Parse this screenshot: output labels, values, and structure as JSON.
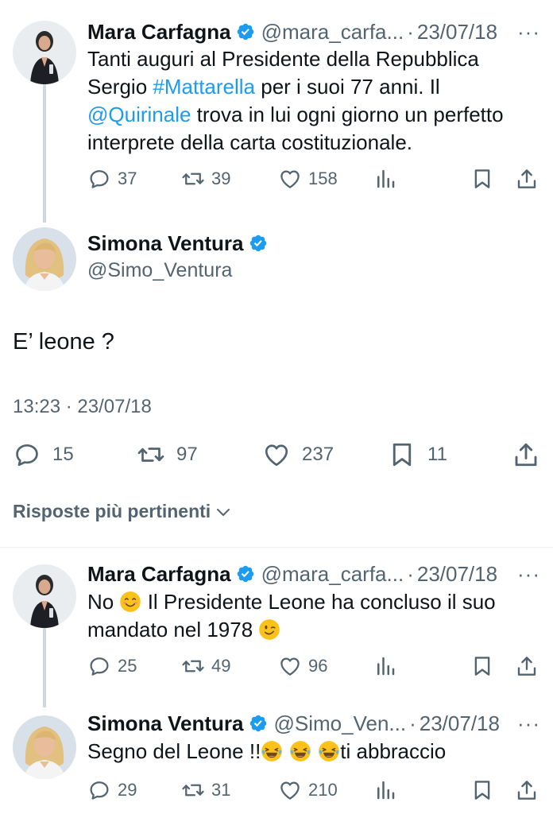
{
  "colors": {
    "accent": "#1d9bf0",
    "muted": "#536471",
    "text": "#0f1419"
  },
  "tweet1": {
    "name": "Mara Carfagna",
    "handle": "@mara_carfa...",
    "date": "23/07/18",
    "more": "···",
    "text_a": "Tanti auguri al Presidente della Repubblica",
    "text_b": "Sergio ",
    "hashtag": "#Mattarella",
    "text_c": " per i suoi 77 anni. Il",
    "mention": "@Quirinale",
    "text_d": " trova in lui ogni giorno un perfetto",
    "text_e": "interprete della carta costituzionale.",
    "replies": "37",
    "retweets": "39",
    "likes": "158"
  },
  "main": {
    "name": "Simona Ventura",
    "handle": "@Simo_Ventura",
    "text": "E’ leone ?",
    "timestamp": "13:23 · 23/07/18",
    "replies": "15",
    "retweets": "97",
    "likes": "237",
    "bookmarks": "11"
  },
  "replies_section": {
    "label": "Risposte più pertinenti"
  },
  "reply1": {
    "name": "Mara Carfagna",
    "handle": "@mara_carfa...",
    "date": "23/07/18",
    "more": "···",
    "text_a": "No ",
    "text_b": " Il Presidente Leone ha concluso il suo",
    "text_c": "mandato nel 1978 ",
    "replies": "25",
    "retweets": "49",
    "likes": "96"
  },
  "reply2": {
    "name": "Simona Ventura",
    "handle": "@Simo_Ven...",
    "date": "23/07/18",
    "more": "···",
    "text_a": "Segno del Leone !!",
    "text_b": "ti abbraccio",
    "replies": "29",
    "retweets": "31",
    "likes": "210"
  }
}
